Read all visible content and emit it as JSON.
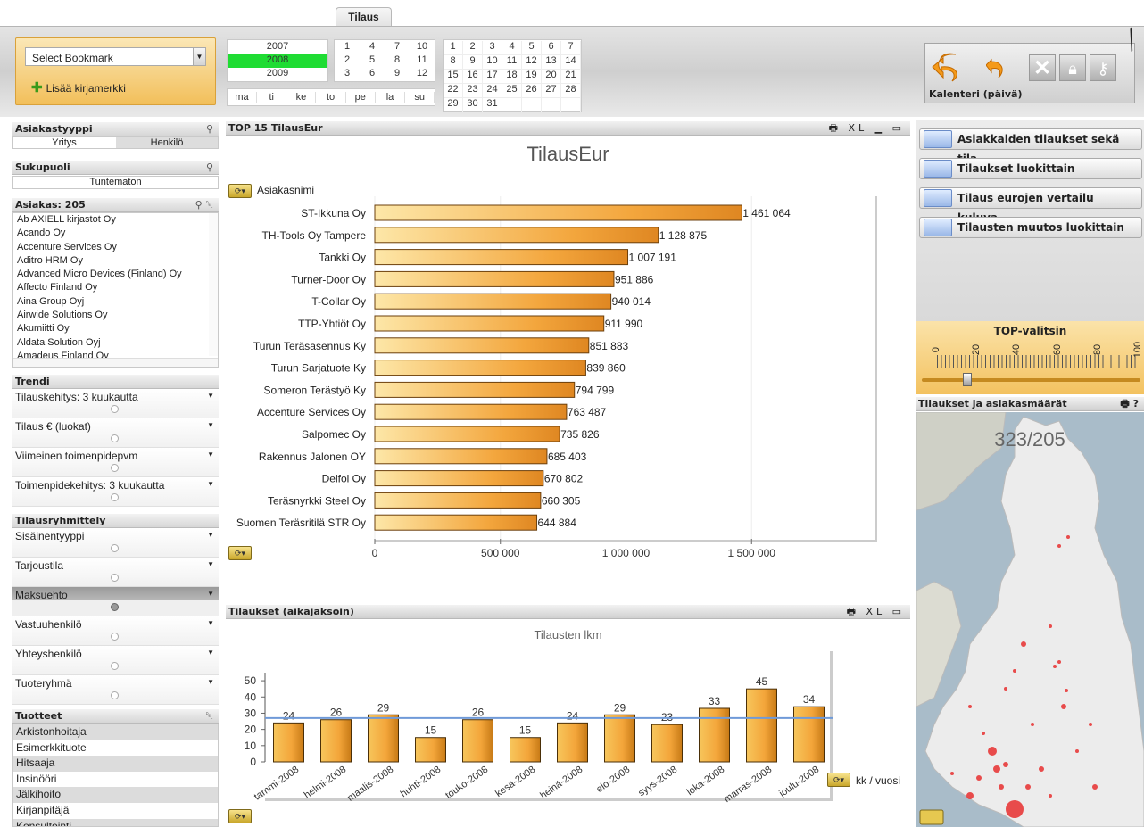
{
  "tab": {
    "label": "Tilaus"
  },
  "bookmark": {
    "select_label": "Select Bookmark",
    "add_label": "Lisää kirjamerkki"
  },
  "calendar": {
    "years": [
      "2007",
      "2008",
      "2009"
    ],
    "selected_year": "2008",
    "months": [
      [
        "1",
        "4",
        "7",
        "10"
      ],
      [
        "2",
        "5",
        "8",
        "11"
      ],
      [
        "3",
        "6",
        "9",
        "12"
      ]
    ],
    "weekdays": [
      "ma",
      "ti",
      "ke",
      "to",
      "pe",
      "la",
      "su"
    ],
    "days": [
      [
        "1",
        "2",
        "3",
        "4",
        "5",
        "6",
        "7"
      ],
      [
        "8",
        "9",
        "10",
        "11",
        "12",
        "13",
        "14"
      ],
      [
        "15",
        "16",
        "17",
        "18",
        "19",
        "20",
        "21"
      ],
      [
        "22",
        "23",
        "24",
        "25",
        "26",
        "27",
        "28"
      ],
      [
        "29",
        "30",
        "31",
        "",
        "",
        "",
        ""
      ]
    ]
  },
  "controls": {
    "caption": "Kalenteri  (päivä)"
  },
  "left": {
    "asiakastyyppi": {
      "title": "Asiakastyyppi",
      "values": [
        "Yritys",
        "Henkilö"
      ]
    },
    "sukupuoli": {
      "title": "Sukupuoli",
      "value": "Tuntematon"
    },
    "asiakas": {
      "title": "Asiakas: 205",
      "items": [
        "Ab AXIELL kirjastot Oy",
        "Acando Oy",
        "Accenture Services Oy",
        "Aditro HRM Oy",
        "Advanced Micro Devices (Finland) Oy",
        "Affecto Finland Oy",
        "Aina Group Oyj",
        "Airwide Solutions Oy",
        "Akumiitti Oy",
        "Aldata Solution Oyj",
        "Amadeus Finland Oy"
      ]
    },
    "trendi": {
      "title": "Trendi",
      "items": [
        "Tilauskehitys: 3 kuukautta",
        "Tilaus € (luokat)",
        "Viimeinen toimenpidepvm",
        "Toimenpidekehitys: 3 kuukautta"
      ]
    },
    "tilausryhmittely": {
      "title": "Tilausryhmittely",
      "items": [
        "Sisäinentyyppi",
        "Tarjoustila",
        "Maksuehto",
        "Vastuuhenkilö",
        "Yhteyshenkilö",
        "Tuoteryhmä"
      ]
    },
    "tuotteet": {
      "title": "Tuotteet",
      "items": [
        "Arkistonhoitaja",
        "Esimerkkituote",
        "Hitsaaja",
        "Insinööri",
        "Jälkihoito",
        "Kirjanpitäjä",
        "Konsultointi"
      ]
    }
  },
  "top15": {
    "panel_title": "TOP 15 TilausEur",
    "icons": "🖶 XL ▁ ▭"
  },
  "tilaukset_panel": {
    "panel_title": "Tilaukset (aikajaksoin)",
    "icons": "🖶 XL ▭",
    "dim_label": "kk / vuosi"
  },
  "right": {
    "buttons": [
      "Asiakkaiden tilaukset sekä tila...",
      "Tilaukset luokittain",
      "Tilaus eurojen vertailu kuluva...",
      "Tilausten muutos luokittain"
    ],
    "slider": {
      "title": "TOP-valitsin",
      "ticks": [
        "0",
        "20",
        "40",
        "60",
        "80",
        "100"
      ],
      "value": 15
    },
    "map": {
      "title": "Tilaukset  ja asiakasmäärät",
      "icons": "🖶 ?",
      "count": "323/205"
    }
  },
  "chart_data": [
    {
      "type": "bar",
      "orientation": "horizontal",
      "title": "TilausEur",
      "dimension_label": "Asiakasnimi",
      "categories": [
        "ST-Ikkuna Oy",
        "TH-Tools Oy Tampere",
        "Tankki Oy",
        "Turner-Door Oy",
        "T-Collar Oy",
        "TTP-Yhtiöt Oy",
        "Turun Teräsasennus Ky",
        "Turun Sarjatuote Ky",
        "Someron Terästyö Ky",
        "Accenture Services Oy",
        "Salpomec Oy",
        "Rakennus Jalonen OY",
        "Delfoi Oy",
        "Teräsnyrkki Steel Oy",
        "Suomen Teräsritilä STR Oy"
      ],
      "values": [
        1461064,
        1128875,
        1007191,
        951886,
        940014,
        911990,
        851883,
        839860,
        794799,
        763487,
        735826,
        685403,
        670802,
        660305,
        644884
      ],
      "value_labels": [
        "1 461 064",
        "1 128 875",
        "1 007 191",
        "951 886",
        "940 014",
        "911 990",
        "851 883",
        "839 860",
        "794 799",
        "763 487",
        "735 826",
        "685 403",
        "670 802",
        "660 305",
        "644 884"
      ],
      "xticks": [
        "0",
        "500 000",
        "1 000 000",
        "1 500 000"
      ],
      "xlim": [
        0,
        2000000
      ]
    },
    {
      "type": "bar",
      "title": "Tilausten lkm",
      "categories": [
        "tammi-2008",
        "helmi-2008",
        "maalis-2008",
        "huhti-2008",
        "touko-2008",
        "kesä-2008",
        "heinä-2008",
        "elo-2008",
        "syys-2008",
        "loka-2008",
        "marras-2008",
        "joulu-2008"
      ],
      "values": [
        24,
        26,
        29,
        15,
        26,
        15,
        24,
        29,
        23,
        33,
        45,
        34
      ],
      "average_line": 27,
      "yticks": [
        "0",
        "10",
        "20",
        "30",
        "40",
        "50"
      ],
      "ylim": [
        0,
        55
      ]
    }
  ]
}
